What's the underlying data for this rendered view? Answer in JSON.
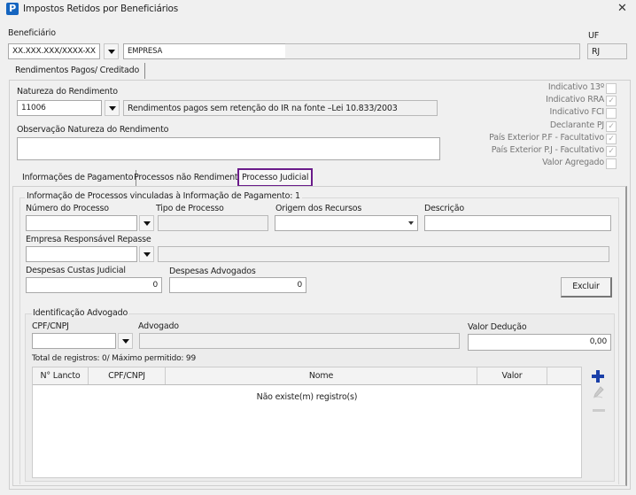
{
  "window": {
    "title": "Impostos Retidos por Beneficiários",
    "app_icon": "P",
    "close": "✕"
  },
  "beneficiario": {
    "label": "Beneficiário",
    "cnpj": "XX.XXX.XXX/XXXX-XX",
    "name": "EMPRESA",
    "uf_label": "UF",
    "uf": "RJ"
  },
  "outer_tab": "Rendimentos Pagos/ Creditado",
  "natureza": {
    "label": "Natureza do Rendimento",
    "code": "11006",
    "description": "Rendimentos pagos sem retenção do IR na fonte –Lei 10.833/2003",
    "obs_label": "Observação Natureza do Rendimento",
    "obs_value": ""
  },
  "checkboxes": [
    {
      "label": "Indicativo 13º",
      "checked": false
    },
    {
      "label": "Indicativo RRA",
      "checked": true
    },
    {
      "label": "Indicativo FCI",
      "checked": false
    },
    {
      "label": "Declarante PJ",
      "checked": true
    },
    {
      "label": "País Exterior P.F - Facultativo",
      "checked": true
    },
    {
      "label": "País Exterior P.J - Facultativo",
      "checked": true
    },
    {
      "label": "Valor Agregado",
      "checked": false
    }
  ],
  "tabs": [
    "Informações de Pagamento",
    "Processos não Rendimento",
    "Processo Judicial"
  ],
  "active_tab_color": "#6a1b8a",
  "processos": {
    "group_label": "Informação de Processos vinculadas à Informação de Pagamento: 1",
    "numero_label": "Número do Processo",
    "tipo_label": "Tipo de Processo",
    "origem_label": "Origem dos Recursos",
    "descricao_label": "Descrição",
    "empresa_label": "Empresa Responsável Repasse",
    "custas_label": "Despesas Custas Judicial",
    "custas_value": "0",
    "advogados_label": "Despesas Advogados",
    "advogados_value": "0",
    "excluir": "Excluir"
  },
  "advogado": {
    "group_label": "Identificação Advogado",
    "cpf_label": "CPF/CNPJ",
    "advogado_label": "Advogado",
    "deducao_label": "Valor Dedução",
    "deducao_value": "0,00",
    "total": "Total de registros: 0/ Máximo permitido: 99",
    "columns": [
      "N° Lancto",
      "CPF/CNPJ",
      "Nome",
      "Valor",
      ""
    ],
    "empty": "Não existe(m) registro(s)"
  }
}
